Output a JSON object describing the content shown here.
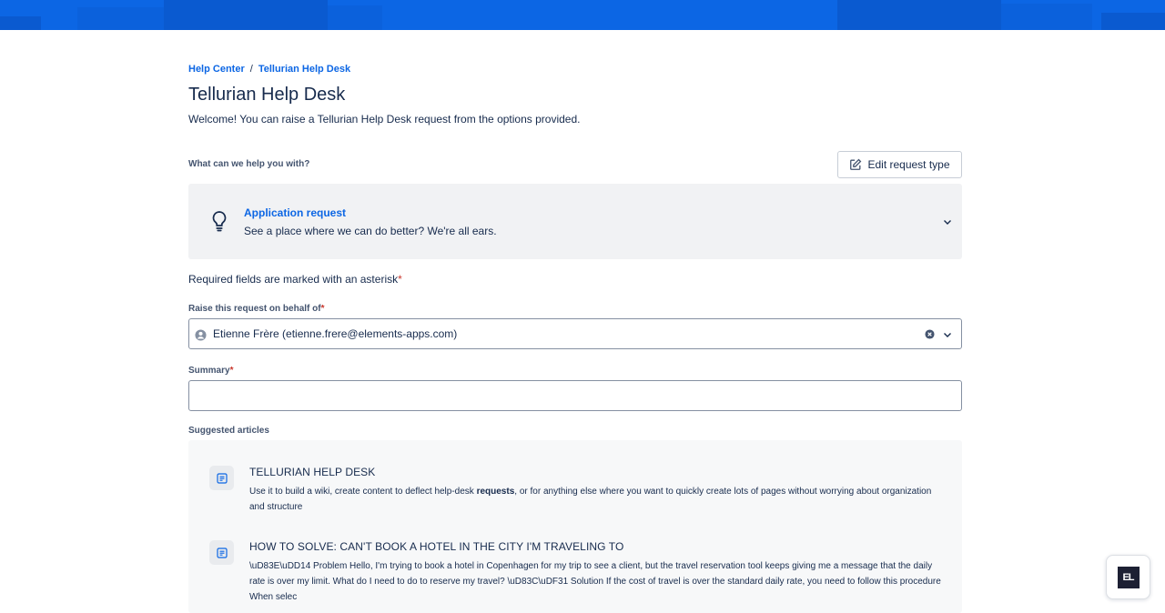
{
  "breadcrumb": {
    "items": [
      "Help Center",
      "Tellurian Help Desk"
    ],
    "separator": "/"
  },
  "page": {
    "title": "Tellurian Help Desk",
    "welcome": "Welcome! You can raise a Tellurian Help Desk request from the options provided."
  },
  "request_type": {
    "section_label": "What can we help you with?",
    "edit_button_label": "Edit request type",
    "selected_title": "Application request",
    "selected_description": "See a place where we can do better? We're all ears.",
    "icon": "lightbulb-icon"
  },
  "form": {
    "required_note": "Required fields are marked with an asterisk",
    "asterisk": "*",
    "on_behalf_label": "Raise this request on behalf of",
    "on_behalf_value": "Etienne Frère (etienne.frere@elements-apps.com)",
    "summary_label": "Summary",
    "summary_value": ""
  },
  "suggested": {
    "label": "Suggested articles",
    "articles": [
      {
        "title": "TELLURIAN HELP DESK",
        "body_before": "Use it to build a wiki, create content to deflect help-desk ",
        "body_bold": "requests",
        "body_after": ", or for anything else where you want to quickly create lots of pages without worrying about organization and structure"
      },
      {
        "title": "HOW TO SOLVE: CAN'T BOOK A HOTEL IN THE CITY I'M TRAVELING TO",
        "body": "\\uD83E\\uDD14  Problem Hello, I'm trying to book a hotel in Copenhagen for my trip to see a client, but the travel reservation tool keeps giving me a message that the daily rate is over my limit. What do I need to do to reserve my travel? \\uD83C\\uDF31  Solution If the cost of travel is over the standard daily rate, you need to follow this procedure When selec"
      }
    ]
  },
  "badge": {
    "logo_text": "EL"
  },
  "colors": {
    "banner": "#0c66e4",
    "link": "#0c66e4",
    "text": "#172b4d",
    "required": "#c9372c",
    "panel": "#f1f2f4"
  }
}
